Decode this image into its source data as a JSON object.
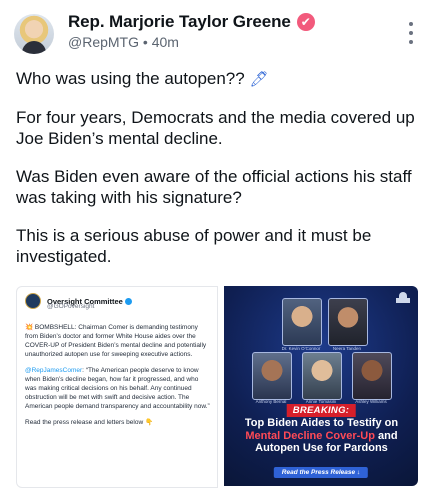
{
  "author": {
    "name": "Rep. Marjorie Taylor Greene",
    "verified_glyph": "✔",
    "handle": "@RepMTG",
    "separator": "•",
    "time": "40m"
  },
  "post": {
    "line1_text": "Who was using the autopen??",
    "line1_emoji": "🖊",
    "line2": "For four years, Democrats and the media covered up Joe Biden’s mental decline.",
    "line3": "Was Biden even aware of the official actions his staff was taking with his signature?",
    "line4": "This is a serious abuse of power and it must be investigated."
  },
  "embed_left": {
    "account_name": "Oversight Committee",
    "account_handle": "@GOPoversight",
    "bombshell_emoji": "💥",
    "paragraph1": "BOMBSHELL: Chairman Comer is demanding testimony from Biden’s doctor and former White House aides over the COVER-UP of President Biden’s mental decline and potentially unauthorized autopen use for sweeping executive actions.",
    "quote_handle": "@RepJamesComer",
    "paragraph2": ": “The American people deserve to know when Biden’s decline began, how far it progressed, and who was making critical decisions on his behalf. Any continued obstruction will be met with swift and decisive action. The American people demand transparency and accountability now.”",
    "paragraph3": "Read the press release and letters below 👇"
  },
  "embed_right": {
    "captions": [
      "Dr. Kevin O’Connor",
      "Neera Tanden",
      "Anthony Bernal",
      "Annie Tomasini",
      "Ashley Williams"
    ],
    "breaking_label": "BREAKING:",
    "headline_part1": "Top Biden Aides to Testify on",
    "headline_red": "Mental Decline Cover-Up",
    "headline_part2": "and Autopen Use for Pardons",
    "button_label": "Read the Press Release ↓"
  },
  "icons": {
    "verified": "verified-badge-icon",
    "more": "more-options-icon",
    "capitol": "capitol-dome-icon"
  },
  "colors": {
    "verified_badge": "#f25a7c",
    "link": "#1d9bf0",
    "breaking_red": "#d61f2b",
    "card_navy": "#0f1f52"
  }
}
